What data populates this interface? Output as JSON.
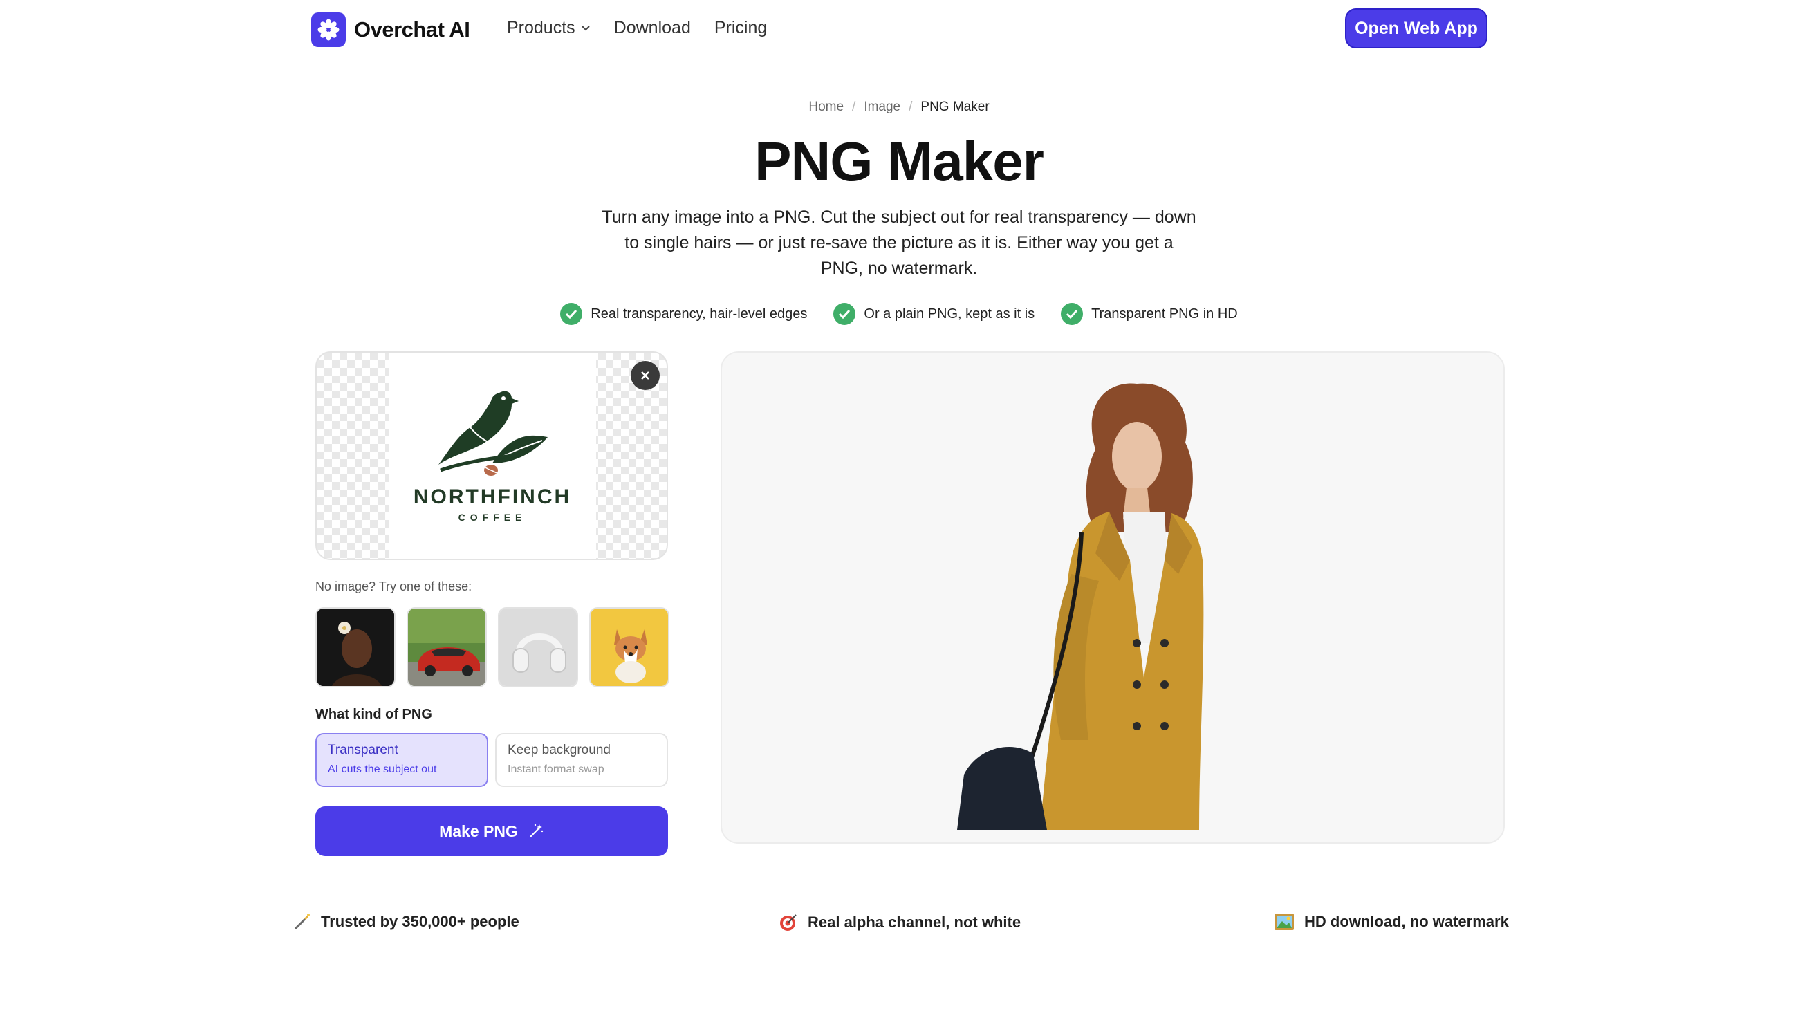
{
  "brand": {
    "name": "Overchat AI",
    "accent": "#4b3ce8"
  },
  "nav": {
    "items": [
      {
        "label": "Products",
        "has_dropdown": true
      },
      {
        "label": "Download"
      },
      {
        "label": "Pricing"
      }
    ],
    "cta": "Open Web App"
  },
  "breadcrumb": {
    "items": [
      "Home",
      "Image",
      "PNG Maker"
    ]
  },
  "hero": {
    "title": "PNG Maker",
    "subtitle": "Turn any image into a PNG. Cut the subject out for real transparency — down to single hairs — or just re-save the picture as it is. Either way you get a PNG, no watermark."
  },
  "features": [
    "Real transparency, hair-level edges",
    "Or a plain PNG, kept as it is",
    "Transparent PNG in HD"
  ],
  "upload": {
    "logo_name": "NORTHFINCH",
    "logo_sub": "COFFEE"
  },
  "samples": {
    "label": "No image? Try one of these:",
    "items": [
      {
        "icon": "portrait-sample"
      },
      {
        "icon": "red-car-sample"
      },
      {
        "icon": "headphones-sample"
      },
      {
        "icon": "corgi-dog-sample"
      }
    ]
  },
  "png_kind": {
    "label": "What kind of PNG",
    "options": [
      {
        "title": "Transparent",
        "desc": "AI cuts the subject out",
        "selected": true
      },
      {
        "title": "Keep background",
        "desc": "Instant format swap",
        "selected": false
      }
    ]
  },
  "make_button": "Make PNG",
  "trust": [
    {
      "icon": "magic-wand-icon",
      "text": "Trusted by 350,000+ people"
    },
    {
      "icon": "target-icon",
      "text": "Real alpha channel, not white"
    },
    {
      "icon": "picture-icon",
      "text": "HD download, no watermark"
    }
  ]
}
